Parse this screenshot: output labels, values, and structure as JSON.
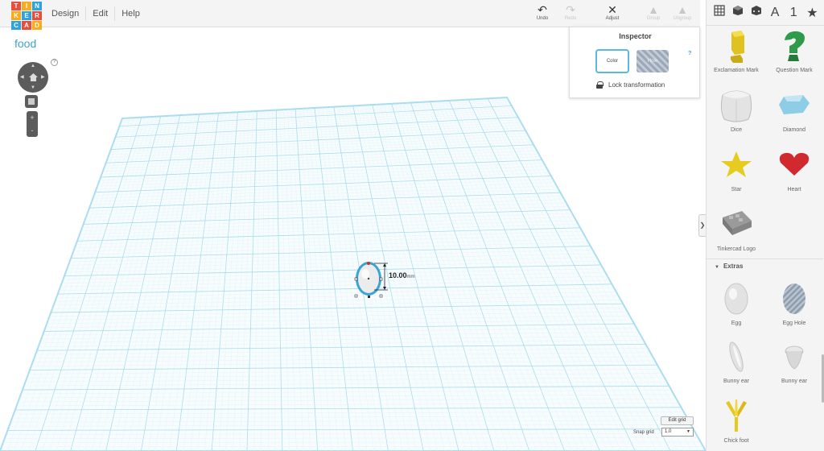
{
  "logo": {
    "letters": [
      "T",
      "I",
      "N",
      "K",
      "E",
      "R",
      "C",
      "A",
      "D"
    ],
    "colors": [
      "#e84e3b",
      "#f6ac1f",
      "#2ea3dc",
      "#f6ac1f",
      "#2ea3dc",
      "#e84e3b",
      "#2ea3dc",
      "#e84e3b",
      "#f6ac1f"
    ]
  },
  "menu": {
    "design": "Design",
    "edit": "Edit",
    "help": "Help"
  },
  "toolbar": {
    "undo": "Undo",
    "redo": "Redo",
    "adjust": "Adjust",
    "group": "Group",
    "ungroup": "Ungroup"
  },
  "project": {
    "name": "food"
  },
  "nav": {
    "help": "?",
    "zoom_in": "+",
    "zoom_out": "-"
  },
  "inspector": {
    "title": "Inspector",
    "color": "Color",
    "hole": "Hole",
    "help": "?",
    "lock": "Lock transformation"
  },
  "dimension": {
    "value": "10.00",
    "unit": "mm"
  },
  "grid": {
    "edit_grid": "Edit grid",
    "snap_label": "Snap grid",
    "snap_value": "1.0"
  },
  "sidebar": {
    "tabs": {
      "shapes": "▦",
      "a": "A",
      "one": "1",
      "star": "★"
    },
    "shapes": [
      {
        "label": "Exclamation Mark"
      },
      {
        "label": "Question Mark"
      },
      {
        "label": "Dice"
      },
      {
        "label": "Diamond"
      },
      {
        "label": "Star"
      },
      {
        "label": "Heart"
      },
      {
        "label": "Tinkercad Logo"
      }
    ],
    "section": "Extras",
    "extras": [
      {
        "label": "Egg"
      },
      {
        "label": "Egg Hole"
      },
      {
        "label": "Bunny ear"
      },
      {
        "label": "Bunny ear"
      },
      {
        "label": "Chick foot"
      }
    ]
  },
  "colors": {
    "accent": "#3ba4d0",
    "grid": "#a9dcee",
    "grid_fine": "#e2f2f8",
    "panel": "#f4f4f4"
  }
}
